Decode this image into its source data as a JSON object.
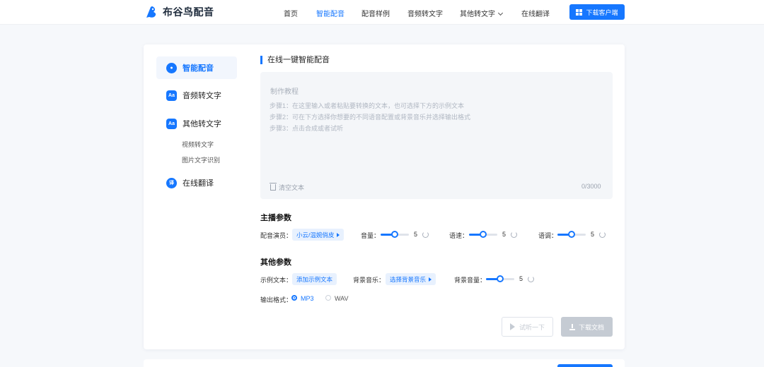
{
  "header": {
    "logo_text": "布谷鸟配音",
    "nav": [
      {
        "label": "首页",
        "active": false
      },
      {
        "label": "智能配音",
        "active": true
      },
      {
        "label": "配音样例",
        "active": false
      },
      {
        "label": "音频转文字",
        "active": false
      },
      {
        "label": "其他转文字",
        "active": false,
        "dropdown": true
      },
      {
        "label": "在线翻译",
        "active": false
      }
    ],
    "download_label": "下载客户端"
  },
  "sidebar": {
    "items": [
      {
        "label": "智能配音",
        "icon": "mic-icon",
        "active": true
      },
      {
        "label": "音频转文字",
        "icon": "aa-icon",
        "active": false
      },
      {
        "label": "其他转文字",
        "icon": "aa-icon",
        "active": false
      },
      {
        "label": "在线翻译",
        "icon": "translate-icon",
        "active": false
      }
    ],
    "sub_items": [
      "视频转文字",
      "图片文字识别"
    ]
  },
  "main": {
    "section_title": "在线一键智能配音",
    "textarea": {
      "placeholder_title": "制作教程",
      "steps": [
        "步骤1：在这里输入或者粘贴要转换的文本，也可选择下方的示例文本",
        "步骤2：可在下方选择你想要的不同语音配置或背景音乐并选择输出格式",
        "步骤3：点击合成或者试听"
      ],
      "clear_label": "清空文本",
      "counter": "0/3000"
    },
    "anchor_params": {
      "title": "主播参数",
      "voice_label": "配音演员：",
      "voice_value": "小云/温婉俏皮",
      "volume_label": "音量：",
      "volume_value": "5",
      "speed_label": "语速：",
      "speed_value": "5",
      "pitch_label": "语调：",
      "pitch_value": "5",
      "slider_level": 0.5
    },
    "other_params": {
      "title": "其他参数",
      "sample_label": "示例文本：",
      "sample_value": "添加示例文本",
      "bgm_label": "背景音乐：",
      "bgm_value": "选择背景音乐",
      "bgm_volume_label": "背景音量：",
      "bgm_volume_value": "5",
      "format_label": "输出格式：",
      "formats": [
        "MP3",
        "WAV"
      ],
      "selected_format": "MP3"
    },
    "actions": {
      "preview_label": "试听一下",
      "download_label": "下载文档"
    }
  },
  "colors": {
    "accent": "#1677ff",
    "disabled": "#c5cbd3",
    "background": "#f6f8fb"
  }
}
